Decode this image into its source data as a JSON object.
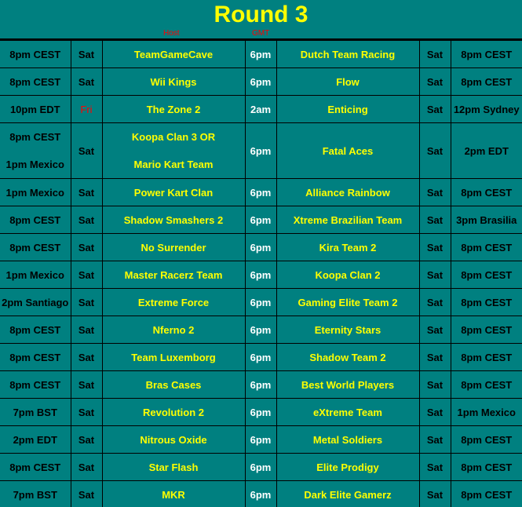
{
  "title": "Round 3",
  "header_labels": {
    "host": "Host",
    "gmt": "GMT"
  },
  "colors": {
    "background": "#008080",
    "team": "#ffff00",
    "gmt": "#ffffff",
    "highlight": "#ff0000"
  },
  "rows": [
    {
      "host_time": "8pm CEST",
      "host_day": "Sat",
      "host": "TeamGameCave",
      "gmt": "6pm",
      "away": "Dutch Team Racing",
      "away_day": "Sat",
      "away_time": "8pm CEST"
    },
    {
      "host_time": "8pm CEST",
      "host_day": "Sat",
      "host": "Wii Kings",
      "gmt": "6pm",
      "away": "Flow",
      "away_day": "Sat",
      "away_time": "8pm CEST"
    },
    {
      "host_time": "10pm EDT",
      "host_day": "Fri",
      "host": "The Zone 2",
      "gmt": "2am",
      "away": "Enticing",
      "away_day": "Sat",
      "away_time": "12pm Sydney",
      "host_day_highlight": true
    },
    {
      "host_time": "8pm CEST",
      "host_time2": "1pm Mexico",
      "host_day": "Sat",
      "host": "Koopa Clan 3 OR",
      "host2": "Mario Kart Team",
      "gmt": "6pm",
      "away": "Fatal Aces",
      "away_day": "Sat",
      "away_time": "2pm EDT"
    },
    {
      "host_time": "1pm Mexico",
      "host_day": "Sat",
      "host": "Power Kart Clan",
      "gmt": "6pm",
      "away": "Alliance Rainbow",
      "away_day": "Sat",
      "away_time": "8pm CEST"
    },
    {
      "host_time": "8pm CEST",
      "host_day": "Sat",
      "host": "Shadow Smashers 2",
      "gmt": "6pm",
      "away": "Xtreme Brazilian Team",
      "away_day": "Sat",
      "away_time": "3pm Brasilia"
    },
    {
      "host_time": "8pm CEST",
      "host_day": "Sat",
      "host": "No Surrender",
      "gmt": "6pm",
      "away": "Kira Team 2",
      "away_day": "Sat",
      "away_time": "8pm CEST"
    },
    {
      "host_time": "1pm Mexico",
      "host_day": "Sat",
      "host": "Master Racerz Team",
      "gmt": "6pm",
      "away": "Koopa Clan 2",
      "away_day": "Sat",
      "away_time": "8pm CEST"
    },
    {
      "host_time": "2pm Santiago",
      "host_day": "Sat",
      "host": "Extreme Force",
      "gmt": "6pm",
      "away": "Gaming Elite Team 2",
      "away_day": "Sat",
      "away_time": "8pm CEST"
    },
    {
      "host_time": "8pm CEST",
      "host_day": "Sat",
      "host": "Nferno 2",
      "gmt": "6pm",
      "away": "Eternity Stars",
      "away_day": "Sat",
      "away_time": "8pm CEST"
    },
    {
      "host_time": "8pm CEST",
      "host_day": "Sat",
      "host": "Team Luxemborg",
      "gmt": "6pm",
      "away": "Shadow Team 2",
      "away_day": "Sat",
      "away_time": "8pm CEST"
    },
    {
      "host_time": "8pm CEST",
      "host_day": "Sat",
      "host": "Bras Cases",
      "gmt": "6pm",
      "away": "Best World Players",
      "away_day": "Sat",
      "away_time": "8pm CEST"
    },
    {
      "host_time": "7pm BST",
      "host_day": "Sat",
      "host": "Revolution 2",
      "gmt": "6pm",
      "away": "eXtreme Team",
      "away_day": "Sat",
      "away_time": "1pm Mexico"
    },
    {
      "host_time": "2pm EDT",
      "host_day": "Sat",
      "host": "Nitrous Oxide",
      "gmt": "6pm",
      "away": "Metal Soldiers",
      "away_day": "Sat",
      "away_time": "8pm CEST"
    },
    {
      "host_time": "8pm CEST",
      "host_day": "Sat",
      "host": "Star Flash",
      "gmt": "6pm",
      "away": "Elite Prodigy",
      "away_day": "Sat",
      "away_time": "8pm CEST"
    },
    {
      "host_time": "7pm BST",
      "host_day": "Sat",
      "host": "MKR",
      "gmt": "6pm",
      "away": "Dark Elite Gamerz",
      "away_day": "Sat",
      "away_time": "8pm CEST"
    }
  ]
}
